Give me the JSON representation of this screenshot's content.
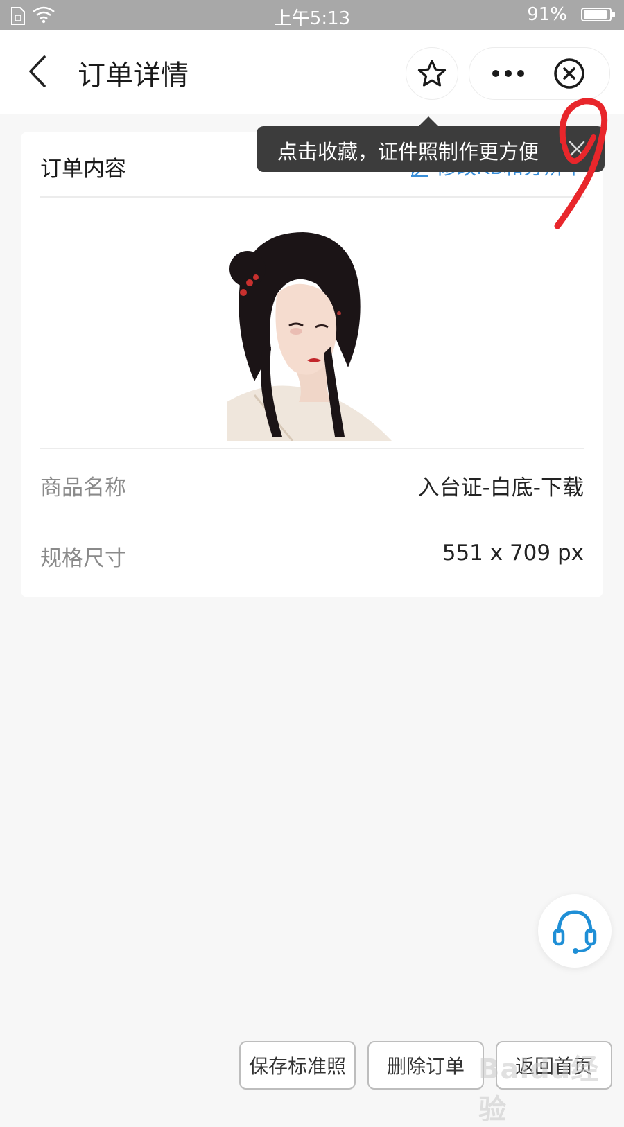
{
  "status_bar": {
    "time": "上午5:13",
    "battery": "91%",
    "battery_level": 0.91
  },
  "nav": {
    "title": "订单详情",
    "icons": [
      "back-icon",
      "star-icon",
      "more-icon",
      "close-circle-icon"
    ]
  },
  "tooltip": {
    "text": "点击收藏，证件照制作更方便"
  },
  "card": {
    "title": "订单内容",
    "edit_link": "修改KB和分辨率",
    "rows": [
      {
        "label": "商品名称",
        "value": "入台证-白底-下载"
      },
      {
        "label": "规格尺寸",
        "value": "551 x 709 px"
      }
    ]
  },
  "buttons": {
    "save": "保存标准照",
    "delete": "删除订单",
    "home": "返回首页"
  },
  "watermark": "Baidu经验",
  "colors": {
    "accent": "#3a8fd9",
    "service": "#1f8fd6",
    "annotation": "#e8262b"
  }
}
